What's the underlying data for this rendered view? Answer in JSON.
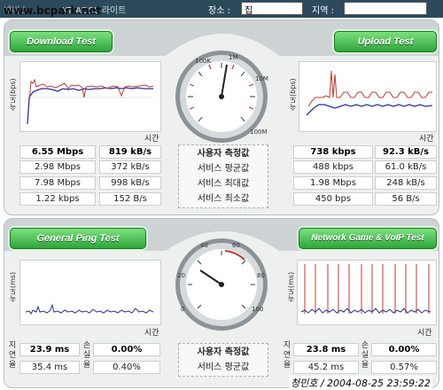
{
  "topbar": {
    "url": "www.bcpark.net",
    "isp_fragment": "넷비스",
    "isp_value": "KT ADSL 라이트",
    "place_label": "장소 :",
    "place_value": "집",
    "region_label": "지역 :",
    "region_value": ""
  },
  "speed_panel": {
    "download_button": "Download Test",
    "upload_button": "Upload Test",
    "y_axis_label": "속도(bps)",
    "x_axis_label": "시간",
    "row_labels": [
      "사용자 측정값",
      "서비스 평균값",
      "서비스 최대값",
      "서비스 최소값"
    ],
    "download_rows": [
      [
        "6.55 Mbps",
        "819 kB/s"
      ],
      [
        "2.98 Mbps",
        "372 kB/s"
      ],
      [
        "7.98 Mbps",
        "998 kB/s"
      ],
      [
        "1.22 kbps",
        "152 B/s"
      ]
    ],
    "upload_rows": [
      [
        "738 kbps",
        "92.3 kB/s"
      ],
      [
        "488 kbps",
        "61.0 kB/s"
      ],
      [
        "1.98 Mbps",
        "248 kB/s"
      ],
      [
        "450 bps",
        "56 B/s"
      ]
    ],
    "gauge_ticks": [
      "100K",
      "1M",
      "10M",
      "100M"
    ]
  },
  "ping_panel": {
    "ping_button": "General Ping Test",
    "game_button": "Network Game & VoIP Test",
    "y_axis_label": "속도(ms)",
    "x_axis_label": "시간",
    "row_labels": [
      "사용자 측정값",
      "서비스 평균값"
    ],
    "latency_label": "지연율",
    "loss_label": "손실율",
    "ping_rows": [
      [
        "23.9 ms",
        "0.00%"
      ],
      [
        "35.4 ms",
        "0.40%"
      ]
    ],
    "game_rows": [
      [
        "23.8 ms",
        "0.00%"
      ],
      [
        "45.2 ms",
        "0.57%"
      ]
    ],
    "gauge_ticks": [
      "0",
      "20",
      "40",
      "60",
      "80",
      "100"
    ]
  },
  "footer": {
    "signature": "청민호 / 2004-08-25 23:59:22"
  },
  "colors": {
    "series_blue": "#2a2f9e",
    "series_red": "#c0392b",
    "button_green": "#2fa53a",
    "topbar_bg": "#2c4a5c"
  }
}
